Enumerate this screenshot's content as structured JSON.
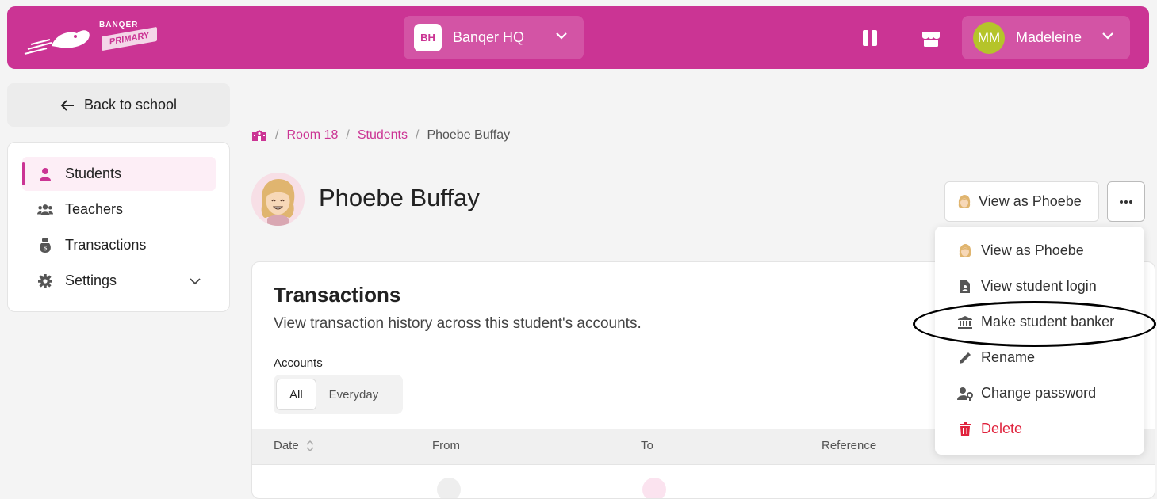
{
  "brand": {
    "logo_top": "BANQER",
    "logo_bottom": "PRIMARY",
    "accent_color": "#cb3494"
  },
  "header": {
    "school_initials": "BH",
    "school_name": "Banqer HQ",
    "user_initials": "MM",
    "user_name": "Madeleine",
    "icons": [
      "pause-icon",
      "shop-icon",
      "chevron-down-icon"
    ]
  },
  "sidebar": {
    "back_label": "Back to school",
    "items": [
      {
        "label": "Students",
        "icon": "student-icon",
        "active": true
      },
      {
        "label": "Teachers",
        "icon": "teachers-icon"
      },
      {
        "label": "Transactions",
        "icon": "money-bag-icon"
      },
      {
        "label": "Settings",
        "icon": "gear-icon"
      }
    ]
  },
  "breadcrumb": {
    "home_icon": "school-icon",
    "items": [
      "Room 18",
      "Students",
      "Phoebe Buffay"
    ]
  },
  "student": {
    "name": "Phoebe Buffay",
    "view_as_label": "View as Phoebe"
  },
  "transactions": {
    "title": "Transactions",
    "subtitle": "View transaction history across this student's accounts.",
    "accounts_label": "Accounts",
    "account_options": [
      "All",
      "Everyday"
    ],
    "selected_account": "All",
    "columns": [
      "Date",
      "From",
      "To",
      "Reference"
    ]
  },
  "menu": {
    "items": [
      {
        "label": "View as Phoebe",
        "icon": "avatar-icon"
      },
      {
        "label": "View student login",
        "icon": "id-badge-icon"
      },
      {
        "label": "Make student banker",
        "icon": "bank-icon"
      },
      {
        "label": "Rename",
        "icon": "pencil-icon"
      },
      {
        "label": "Change password",
        "icon": "user-key-icon"
      },
      {
        "label": "Delete",
        "icon": "trash-icon",
        "danger": true
      }
    ]
  }
}
